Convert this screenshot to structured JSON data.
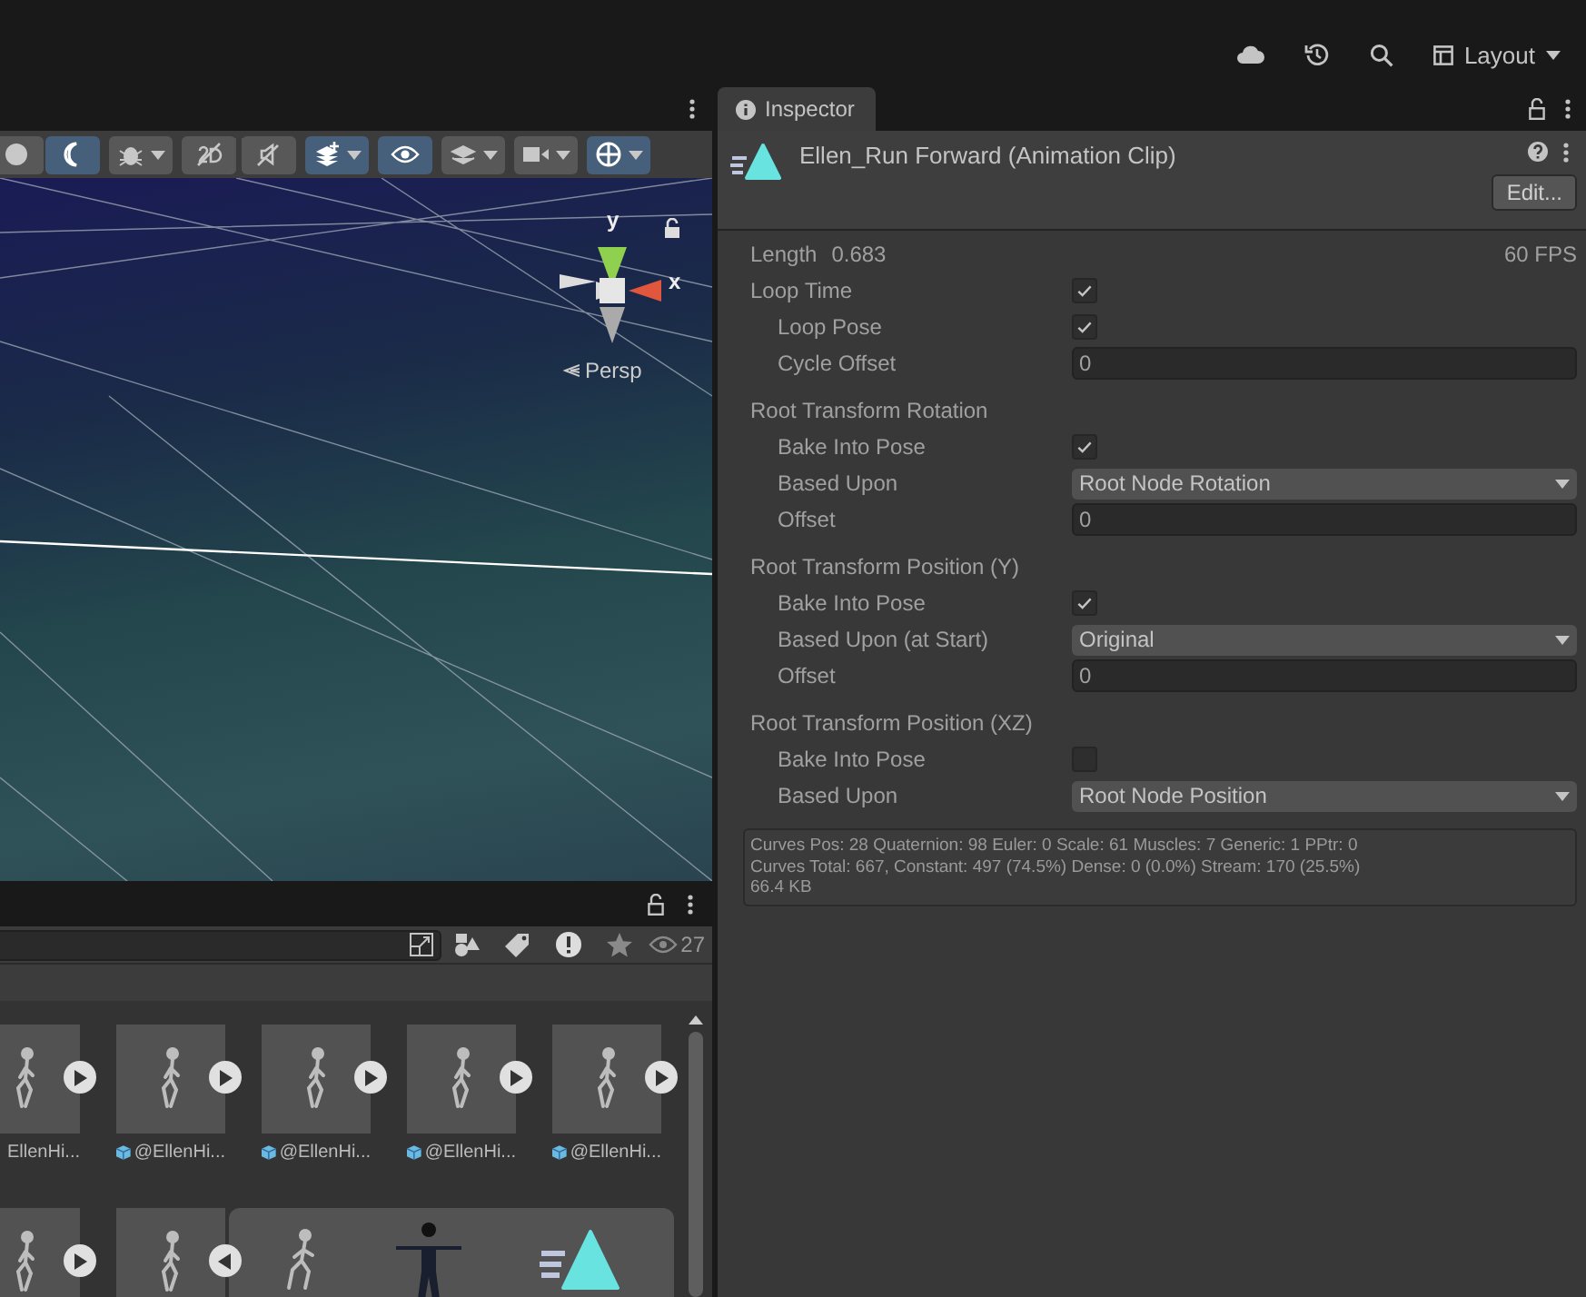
{
  "top_bar": {
    "layout_button": "Layout"
  },
  "scene_view": {
    "toolbar": [
      {
        "kind": "sphere",
        "selected": false,
        "dropdown": false
      },
      {
        "kind": "moon",
        "selected": true,
        "dropdown": false
      },
      {
        "kind": "bug",
        "selected": false,
        "dropdown": true
      },
      {
        "kind": "flat",
        "selected": false,
        "dropdown": false
      },
      {
        "kind": "audio",
        "selected": false,
        "dropdown": false
      },
      {
        "kind": "effects",
        "selected": true,
        "dropdown": true
      },
      {
        "kind": "eye",
        "selected": true,
        "dropdown": false
      },
      {
        "kind": "layers",
        "selected": false,
        "dropdown": true
      },
      {
        "kind": "camera",
        "selected": false,
        "dropdown": true
      },
      {
        "kind": "gizmo",
        "selected": true,
        "dropdown": true
      }
    ],
    "gizmo": {
      "y_label": "y",
      "x_label": "x",
      "projection": "Persp"
    }
  },
  "project": {
    "visible_count": "27",
    "rows": [
      [
        {
          "label": "EllenHi...",
          "expanded": false
        },
        {
          "label": "@EllenHi...",
          "package_icon": true,
          "expanded": false
        },
        {
          "label": "@EllenHi...",
          "package_icon": true,
          "expanded": false
        },
        {
          "label": "@EllenHi...",
          "package_icon": true,
          "expanded": false
        },
        {
          "label": "@EllenHi...",
          "package_icon": true,
          "expanded": false
        }
      ],
      [
        {
          "expanded": false
        },
        {
          "expanded": true
        }
      ]
    ]
  },
  "inspector": {
    "tab": "Inspector",
    "title": "Ellen_Run Forward (Animation Clip)",
    "edit_button": "Edit...",
    "length_label": "Length",
    "length": "0.683",
    "fps": "60 FPS",
    "sections": [
      {
        "kind": "checkbox",
        "label": "Loop Time",
        "checked": true,
        "children": [
          {
            "kind": "checkbox",
            "label": "Loop Pose",
            "checked": true
          },
          {
            "kind": "number",
            "label": "Cycle Offset",
            "value": "0"
          }
        ]
      },
      {
        "kind": "heading",
        "label": "Root Transform Rotation",
        "children": [
          {
            "kind": "checkbox",
            "label": "Bake Into Pose",
            "checked": true
          },
          {
            "kind": "dropdown",
            "label": "Based Upon",
            "value": "Root Node Rotation"
          },
          {
            "kind": "number",
            "label": "Offset",
            "value": "0"
          }
        ]
      },
      {
        "kind": "heading",
        "label": "Root Transform Position (Y)",
        "children": [
          {
            "kind": "checkbox",
            "label": "Bake Into Pose",
            "checked": true
          },
          {
            "kind": "dropdown",
            "label": "Based Upon (at Start)",
            "value": "Original"
          },
          {
            "kind": "number",
            "label": "Offset",
            "value": "0"
          }
        ]
      },
      {
        "kind": "heading",
        "label": "Root Transform Position (XZ)",
        "children": [
          {
            "kind": "checkbox",
            "label": "Bake Into Pose",
            "checked": false
          },
          {
            "kind": "dropdown",
            "label": "Based Upon",
            "value": "Root Node Position"
          }
        ]
      }
    ],
    "info": [
      "Curves Pos: 28 Quaternion: 98 Euler: 0 Scale: 61 Muscles: 7 Generic: 1 PPtr: 0",
      "Curves Total: 667, Constant: 497 (74.5%) Dense: 0 (0.0%) Stream: 170 (25.5%)",
      "66.4 KB"
    ]
  }
}
